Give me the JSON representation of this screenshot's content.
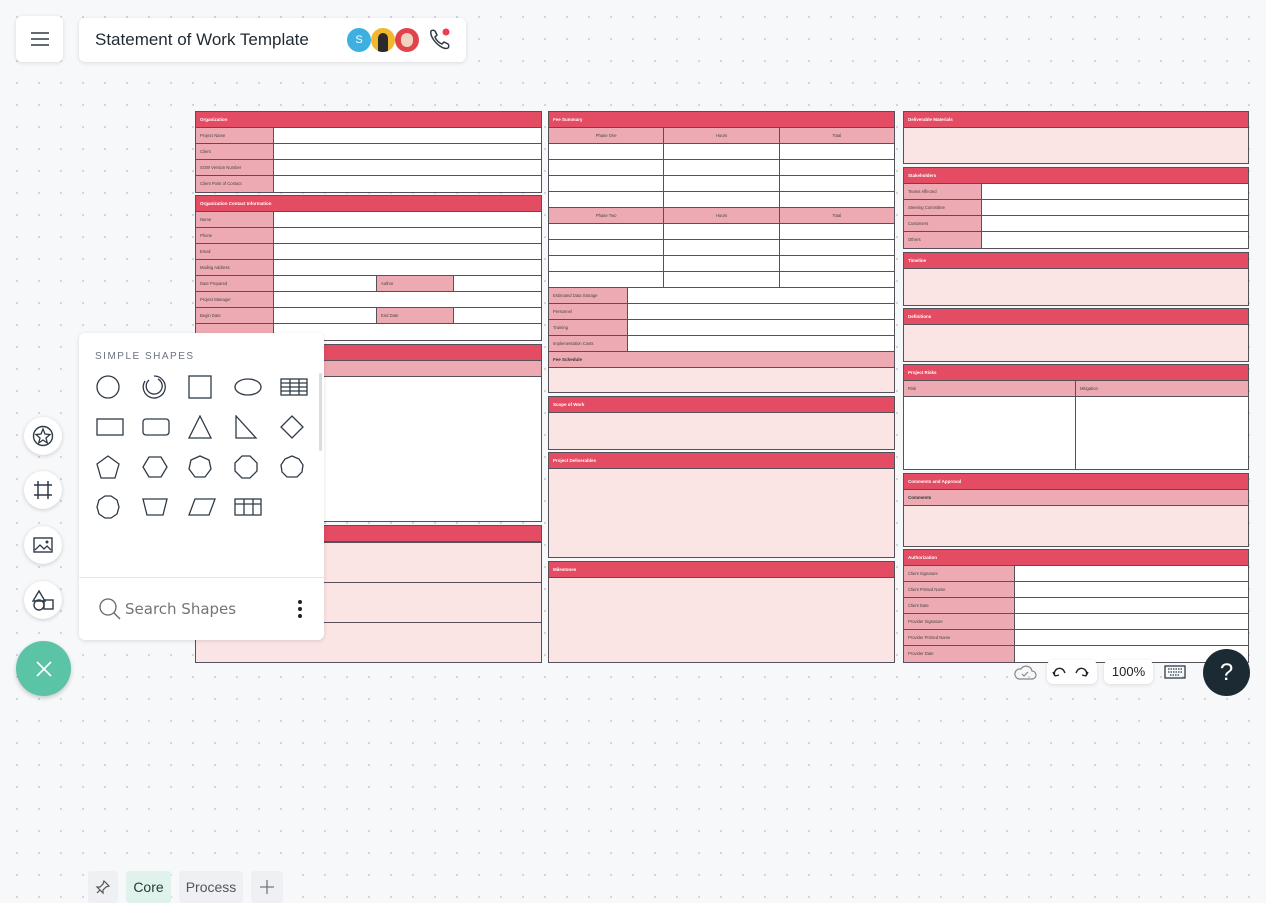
{
  "header": {
    "title": "Statement of Work Template",
    "menu_icon": "hamburger-icon",
    "avatars": [
      {
        "initial": "S",
        "color": "#3db0e0"
      },
      {
        "initial": "",
        "color": "#f2b72f"
      },
      {
        "initial": "",
        "color": "#e0434b"
      }
    ],
    "call_icon": "phone-icon",
    "call_badge_color": "#ef3b4a"
  },
  "colors": {
    "header": "#e44c63",
    "label": "#eeaab2",
    "pale": "#fae4e4",
    "fab": "#5cc4a6",
    "help": "#1c2b33"
  },
  "document": {
    "left": [
      {
        "title": "Organization",
        "rows": [
          [
            "Project Name"
          ],
          [
            "Client"
          ],
          [
            "SOW Version Number"
          ],
          [
            "Client Point of Contact"
          ]
        ]
      },
      {
        "title": "Organization Contact Information",
        "rows": [
          [
            "Name"
          ],
          [
            "Phone"
          ],
          [
            "Email"
          ],
          [
            "Mailing Address"
          ],
          [
            "Date Prepared",
            "Author"
          ],
          [
            "Project Manager"
          ],
          [
            "Begin Date",
            "End Date"
          ],
          [
            ""
          ]
        ]
      },
      {
        "title": "",
        "subheader": "",
        "body": "white"
      },
      {
        "title": "",
        "pale_rows": 3
      }
    ],
    "middle": [
      {
        "title": "Fee Summary",
        "tables": [
          {
            "headers": [
              "Phase One",
              "Hours",
              "Total"
            ],
            "rows": 4
          },
          {
            "headers": [
              "Phase Two",
              "Hours",
              "Total"
            ],
            "rows": 4
          }
        ],
        "rows": [
          [
            "Estimated Data Storage"
          ],
          [
            "Personnel"
          ],
          [
            "Training"
          ],
          [
            "Implementation Costs"
          ]
        ],
        "subheader": "Fee Schedule",
        "body": "pale"
      },
      {
        "title": "Scope of Work",
        "body": "pale"
      },
      {
        "title": "Project Deliverables",
        "body": "pale"
      },
      {
        "title": "Milestones",
        "body": "pale"
      }
    ],
    "right": [
      {
        "title": "Deliverable Materials",
        "body": "pale"
      },
      {
        "title": "Stakeholders",
        "rows": [
          [
            "Teams Affected"
          ],
          [
            "Steering Committee"
          ],
          [
            "Customers"
          ],
          [
            "Others"
          ]
        ]
      },
      {
        "title": "Timeline",
        "body": "pale"
      },
      {
        "title": "Definitions",
        "body": "pale"
      },
      {
        "title": "Project Risks",
        "tables": [
          {
            "headers": [
              "Risk",
              "Mitigation"
            ],
            "rows": 0
          }
        ],
        "body": "split"
      },
      {
        "title": "Comments and Approval",
        "subheader": "Comments",
        "body": "pale"
      },
      {
        "title": "Authorization",
        "rows": [
          [
            "Client Signature"
          ],
          [
            "Client Printed Name"
          ],
          [
            "Client Date"
          ],
          [
            "Provider Signature"
          ],
          [
            "Provider Printed Name"
          ],
          [
            "Provider Date"
          ]
        ]
      }
    ]
  },
  "shapes_panel": {
    "section_title": "SIMPLE SHAPES",
    "shapes": [
      "circle",
      "arc",
      "square",
      "ellipse",
      "table-striped",
      "rectangle",
      "rounded-rectangle",
      "triangle",
      "right-triangle",
      "diamond",
      "pentagon",
      "hexagon",
      "heptagon",
      "octagon",
      "nonagon",
      "decagon",
      "trapezoid",
      "parallelogram",
      "grid-table"
    ],
    "tabs": {
      "pin_icon": "pin-icon",
      "core": "Core",
      "process": "Process",
      "add_icon": "plus-icon"
    },
    "search_placeholder": "Search Shapes"
  },
  "left_toolbar": [
    "star-shapes-icon",
    "frame-icon",
    "image-icon",
    "shapes-icon"
  ],
  "bottom": {
    "zoom": "100%",
    "help": "?"
  }
}
